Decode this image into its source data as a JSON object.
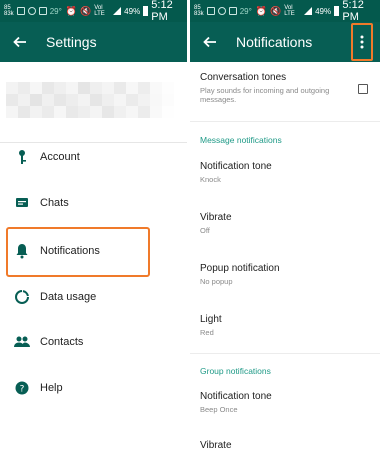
{
  "status_bar_left": {
    "carrier_small": "85\n83k",
    "temperature": "29°",
    "network": "Vol LTE",
    "battery": "49%",
    "time": "5:12 PM"
  },
  "status_bar_right": {
    "carrier_small": "85\n83k",
    "temperature": "29°",
    "network": "Vol LTE",
    "battery": "49%",
    "time": "5:12 PM"
  },
  "settings": {
    "title": "Settings",
    "items": [
      {
        "label": "Account",
        "icon": "key-icon"
      },
      {
        "label": "Chats",
        "icon": "chat-icon"
      },
      {
        "label": "Notifications",
        "icon": "bell-icon"
      },
      {
        "label": "Data usage",
        "icon": "data-usage-icon"
      },
      {
        "label": "Contacts",
        "icon": "contacts-icon"
      },
      {
        "label": "Help",
        "icon": "help-icon"
      }
    ]
  },
  "notifications": {
    "title": "Notifications",
    "conversation_tones": {
      "title": "Conversation tones",
      "subtitle": "Play sounds for incoming and outgoing messages.",
      "checked": false
    },
    "message_header": "Message notifications",
    "message_items": [
      {
        "title": "Notification tone",
        "subtitle": "Knock"
      },
      {
        "title": "Vibrate",
        "subtitle": "Off"
      },
      {
        "title": "Popup notification",
        "subtitle": "No popup"
      },
      {
        "title": "Light",
        "subtitle": "Red"
      }
    ],
    "group_header": "Group notifications",
    "group_items": [
      {
        "title": "Notification tone",
        "subtitle": "Beep Once"
      },
      {
        "title": "Vibrate",
        "subtitle": ""
      }
    ]
  },
  "colors": {
    "status_bar": "#04594d",
    "toolbar": "#075e54",
    "accent": "#1f9a87",
    "highlight": "#f07a2a"
  }
}
